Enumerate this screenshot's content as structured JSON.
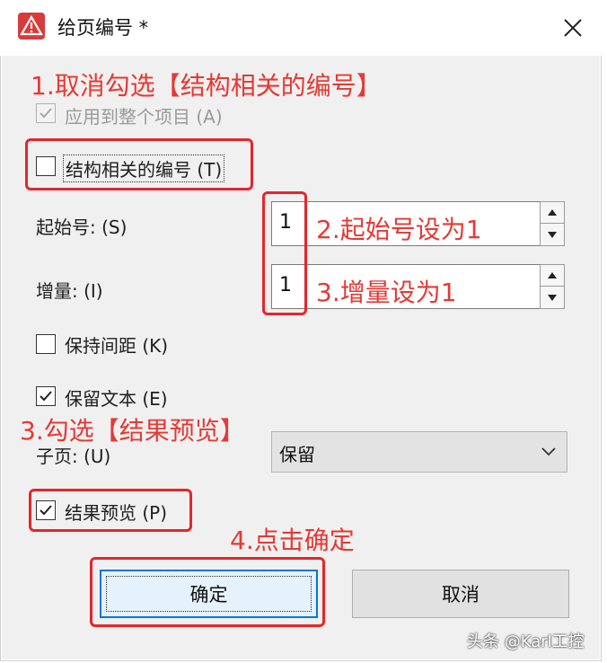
{
  "window": {
    "title": "给页编号 *",
    "close_icon": "close-icon",
    "app_icon": "warning-triangle-icon"
  },
  "annotations": {
    "step1": "1.取消勾选【结构相关的编号】",
    "step2": "2.起始号设为1",
    "step3a": "3.增量设为1",
    "step3b": "3.勾选【结果预览】",
    "step4": "4.点击确定",
    "color": "#e53935"
  },
  "options": {
    "apply_whole_project": {
      "label": "应用到整个项目 (A)",
      "checked": true,
      "enabled": false
    },
    "structure_related": {
      "label": "结构相关的编号 (T)",
      "checked": false
    },
    "keep_spacing": {
      "label": "保持间距 (K)",
      "checked": false
    },
    "keep_text": {
      "label": "保留文本 (E)",
      "checked": true
    },
    "result_preview": {
      "label": "结果预览 (P)",
      "checked": true
    }
  },
  "fields": {
    "start_number": {
      "label": "起始号: (S)",
      "value": "1"
    },
    "increment": {
      "label": "增量: (I)",
      "value": "1"
    },
    "subpage": {
      "label": "子页: (U)",
      "selected": "保留"
    }
  },
  "buttons": {
    "ok": "确定",
    "cancel": "取消"
  },
  "watermark": "头条 @Karl工控"
}
